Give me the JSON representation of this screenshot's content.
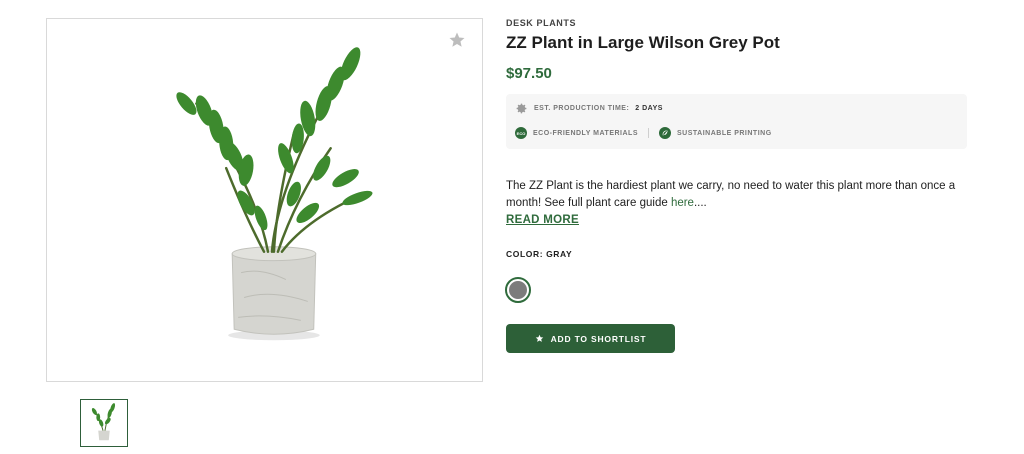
{
  "product": {
    "category": "DESK PLANTS",
    "title": "ZZ Plant in Large Wilson Grey Pot",
    "price": "$97.50"
  },
  "info": {
    "production_label": "EST. PRODUCTION TIME:",
    "production_value": "2 DAYS",
    "eco_badge": "ECO",
    "eco_label": "ECO-FRIENDLY MATERIALS",
    "sustainable_label": "SUSTAINABLE PRINTING"
  },
  "description": {
    "text": "The ZZ Plant is the hardiest plant we carry, no need to water this plant more than once a month! See full plant care guide ",
    "link": "here",
    "ellipsis": "....",
    "read_more": "READ MORE"
  },
  "color": {
    "label": "COLOR: GRAY",
    "selected_hex": "#7c7c7c"
  },
  "actions": {
    "shortlist_label": "ADD TO SHORTLIST"
  },
  "icons": {
    "favorite": "star-icon",
    "production": "gear-icon",
    "eco": "eco-icon",
    "sustainable": "leaf-icon",
    "shortlist": "star-icon"
  },
  "colors": {
    "accent": "#2f6b3c",
    "button": "#2d6038",
    "info_bg": "#f6f6f6"
  }
}
